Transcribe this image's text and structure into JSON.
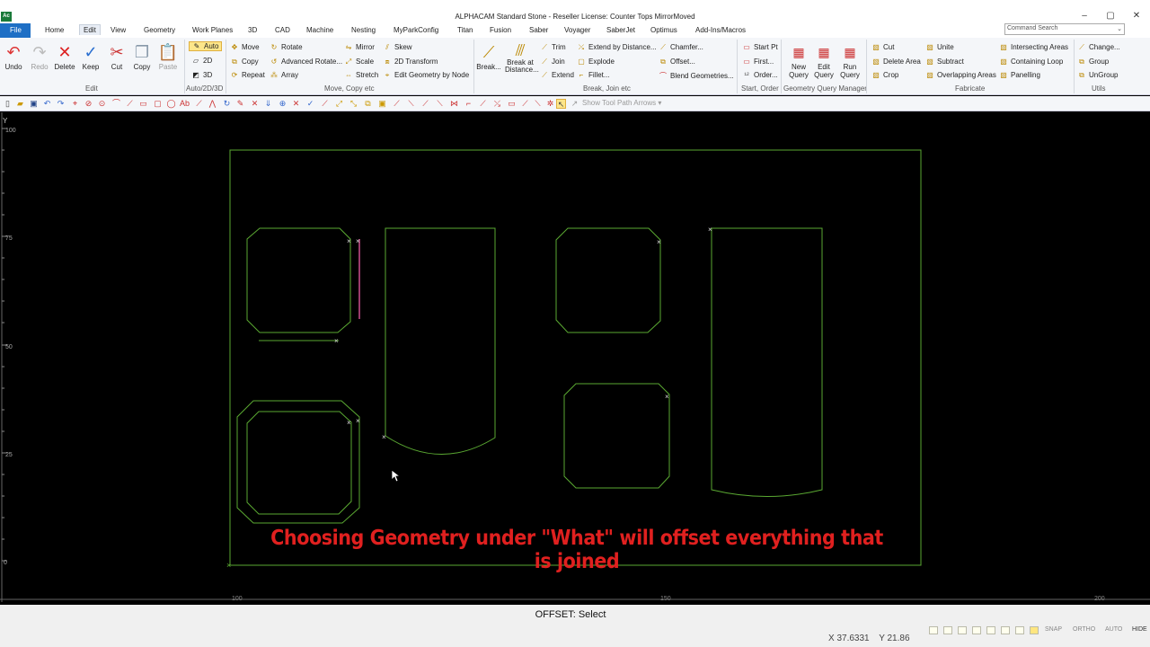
{
  "app": {
    "title": "ALPHACAM Standard Stone - Reseller License: Counter Tops MirrorMoved",
    "icon_label": "Ac"
  },
  "window_buttons": [
    "–",
    "▢",
    "✕"
  ],
  "menu": {
    "file": "File",
    "tabs": [
      "Home",
      "Edit",
      "View",
      "Geometry",
      "Work Planes",
      "3D",
      "CAD",
      "Machine",
      "Nesting",
      "MyParkConfig",
      "Titan",
      "Fusion",
      "Saber",
      "Voyager",
      "SaberJet",
      "Optimus",
      "Add-Ins/Macros"
    ],
    "active_tab": "Edit"
  },
  "search": {
    "placeholder": "Command Search"
  },
  "ribbon": {
    "undo": "Undo",
    "redo": "Redo",
    "delete": "Delete",
    "keep": "Keep",
    "cut": "Cut",
    "copy": "Copy",
    "paste": "Paste",
    "group_edit": "Edit",
    "auto": "Auto",
    "d2": "2D",
    "d3": "3D",
    "group_auto": "Auto/2D/3D",
    "move": "Move",
    "copy_small": "Copy",
    "repeat": "Repeat",
    "rotate": "Rotate",
    "advanced_rotate": "Advanced Rotate...",
    "array": "Array",
    "mirror": "Mirror",
    "scale": "Scale",
    "stretch": "Stretch",
    "skew": "Skew",
    "transform2d": "2D Transform",
    "edit_geometry_by_node": "Edit Geometry by Node",
    "group_move": "Move, Copy etc",
    "break": "Break...",
    "break_at_distance": "Break at Distance...",
    "trim": "Trim",
    "join": "Join",
    "extend": "Extend",
    "extend_by_distance": "Extend by Distance...",
    "explode": "Explode",
    "fillet": "Fillet...",
    "chamfer": "Chamfer...",
    "offset": "Offset...",
    "blend_geometries": "Blend Geometries...",
    "group_break": "Break, Join etc",
    "start_pt": "Start Pt",
    "first": "First...",
    "order": "Order...",
    "group_start": "Start, Order",
    "new_query": "New Query",
    "edit_query": "Edit Query",
    "run_query": "Run Query",
    "group_query": "Geometry Query Manager",
    "cut2": "Cut",
    "delete_area": "Delete Area",
    "crop": "Crop",
    "unite": "Unite",
    "subtract": "Subtract",
    "overlapping_areas": "Overlapping Areas",
    "intersecting_areas": "Intersecting Areas",
    "containing_loop": "Containing Loop",
    "panelling": "Panelling",
    "group_fabricate": "Fabricate",
    "change": "Change...",
    "group_btn": "Group",
    "ungroup": "UnGroup",
    "group_utils": "Utils"
  },
  "toolbar2": {
    "show_tool_path_arrows": "Show Tool Path Arrows"
  },
  "canvas": {
    "axis_y_label": "Y",
    "ruler_y_labels": [
      "100",
      "75",
      "50",
      "25",
      "0"
    ],
    "ruler_x_labels": [
      "100",
      "150",
      "200"
    ],
    "caption": "Choosing Geometry under \"What\" will offset everything that is joined",
    "colors": {
      "geometry": "#5aa832",
      "background": "#000000",
      "selected": "#9a3a6a",
      "caption": "#e0201f"
    }
  },
  "status": {
    "prompt": "OFFSET: Select",
    "x_coord": "X 37.6331",
    "y_coord": "Y 21.86",
    "snap": "SNAP",
    "ortho": "ORTHO",
    "auto": "AUTO",
    "hide": "HIDE"
  }
}
